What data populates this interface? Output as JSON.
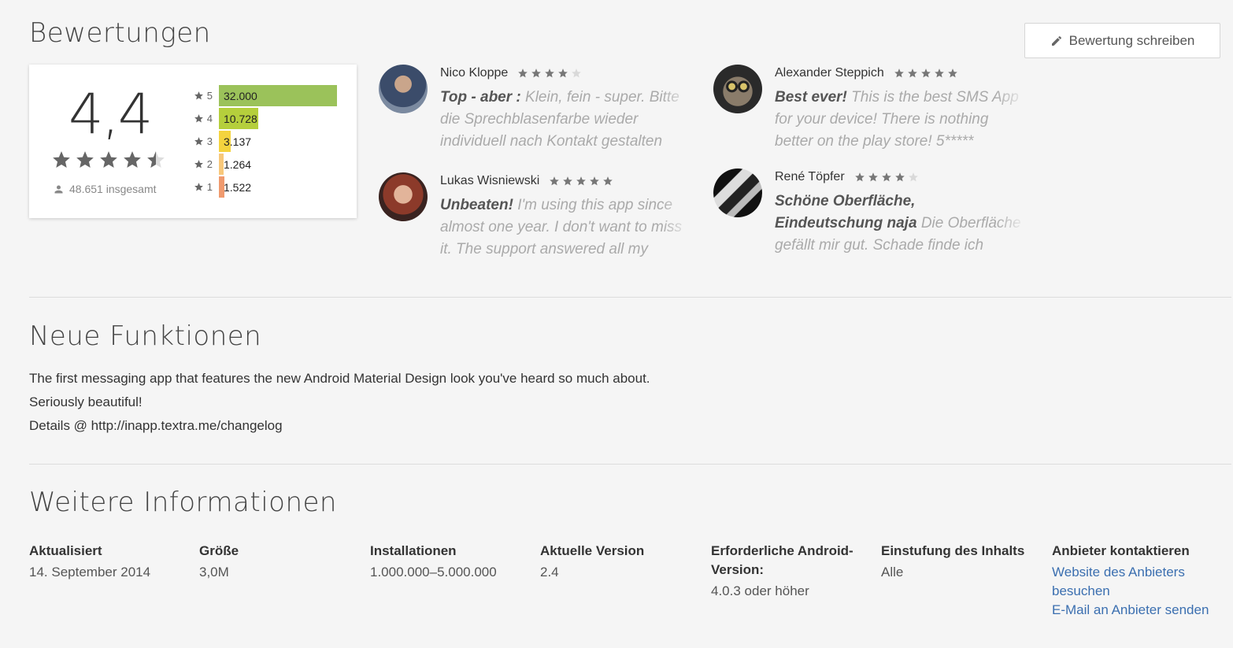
{
  "ratings": {
    "title": "Bewertungen",
    "write_review_label": "Bewertung schreiben",
    "score": "4,4",
    "total": "48.651 insgesamt",
    "histogram": [
      {
        "label": "5",
        "count": "32.000",
        "value": 32000,
        "color": "#9bc25a"
      },
      {
        "label": "4",
        "count": "10.728",
        "value": 10728,
        "color": "#b5cf3c"
      },
      {
        "label": "3",
        "count": "3.137",
        "value": 3137,
        "color": "#f4d33e"
      },
      {
        "label": "2",
        "count": "1.264",
        "value": 1264,
        "color": "#f8c87a"
      },
      {
        "label": "1",
        "count": "1.522",
        "value": 1522,
        "color": "#f09a6e"
      }
    ]
  },
  "reviews": [
    {
      "name": "Nico Kloppe",
      "stars": 4,
      "title": "Top - aber :",
      "text": "Klein, fein - super. Bitte die Sprechblasenfarbe wieder individuell nach Kontakt gestalten lassen. Und die"
    },
    {
      "name": "Alexander Steppich",
      "stars": 5,
      "title": "Best ever!",
      "text": "This is the best SMS App for your device! There is nothing better on the play store! 5*****"
    },
    {
      "name": "Lukas Wisniewski",
      "stars": 5,
      "title": "Unbeaten!",
      "text": "I'm using this app since almost one year. I don't want to miss it. The support answered all my"
    },
    {
      "name": "René Töpfer",
      "stars": 4,
      "title": "Schöne Oberfläche, Eindeutschung naja",
      "text": "Die Oberfläche gefällt mir gut. Schade finde ich jedoch zwei Dinge:"
    }
  ],
  "new_features": {
    "title": "Neue Funktionen",
    "lines": [
      "The first messaging app that features the new Android Material Design look you've heard so much about.",
      "Seriously beautiful!",
      "Details @ http://inapp.textra.me/changelog"
    ]
  },
  "more_info": {
    "title": "Weitere Informationen",
    "updated_label": "Aktualisiert",
    "updated_value": "14. September 2014",
    "size_label": "Größe",
    "size_value": "3,0M",
    "installs_label": "Installationen",
    "installs_value": "1.000.000–5.000.000",
    "version_label": "Aktuelle Version",
    "version_value": "2.4",
    "android_label": "Erforderliche Android-Version:",
    "android_value": "4.0.3 oder höher",
    "rating_label": "Einstufung des Inhalts",
    "rating_value": "Alle",
    "contact_label": "Anbieter kontaktieren",
    "contact_website": "Website des Anbieters besuchen",
    "contact_email": "E-Mail an Anbieter senden"
  }
}
